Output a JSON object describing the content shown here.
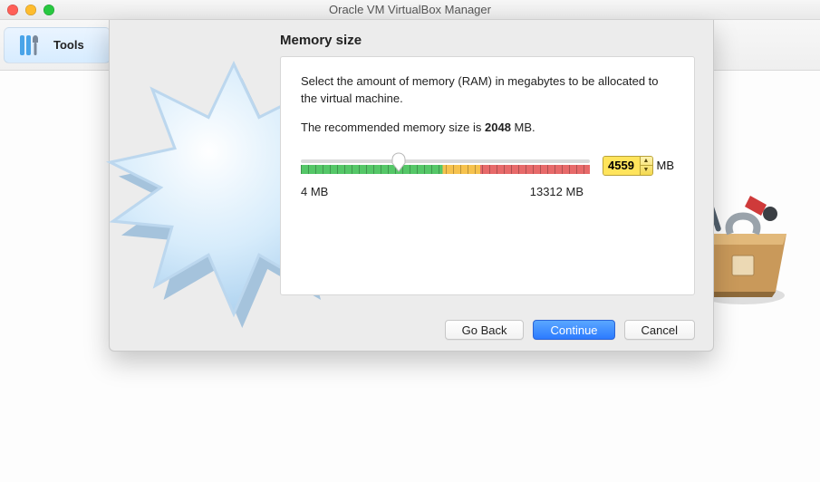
{
  "window": {
    "title": "Oracle VM VirtualBox Manager"
  },
  "sidebar": {
    "tools_label": "Tools"
  },
  "dialog": {
    "heading": "Memory size",
    "instruction": "Select the amount of memory (RAM) in megabytes to be allocated to the virtual machine.",
    "recommended_prefix": "The recommended memory size is ",
    "recommended_value": "2048",
    "recommended_suffix": " MB.",
    "slider": {
      "min_label": "4 MB",
      "max_label": "13312 MB",
      "min": 4,
      "max": 13312,
      "value": 4559,
      "thumb_percent": 34
    },
    "unit": "MB",
    "buttons": {
      "back": "Go Back",
      "continue": "Continue",
      "cancel": "Cancel"
    }
  }
}
